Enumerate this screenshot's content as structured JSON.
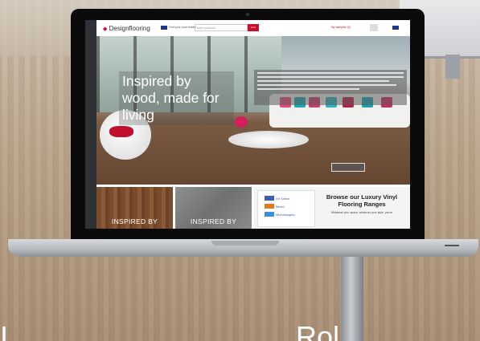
{
  "site": {
    "logo_text": "Designflooring",
    "dealer_text": "Find your local retailer",
    "search_placeholder": "enter postcode",
    "search_button": "Find",
    "samples_text": "My samples (0)",
    "lang_text": "EN"
  },
  "hero": {
    "title": "Inspired by wood, made for living"
  },
  "tiles": {
    "tile1_label": "INSPIRED BY",
    "tile2_label": "INSPIRED BY",
    "swatches": [
      {
        "name": "Art Select",
        "color": "#3f5fa8"
      },
      {
        "name": "Mixed",
        "color": "#e37a1f"
      },
      {
        "name": "Michelangelo",
        "color": "#3a8fd6"
      }
    ],
    "browse_title": "Browse our Luxury Vinyl Flooring Ranges",
    "browse_sub": "Whatever your space, whatever your style, you're"
  },
  "bottom_text": {
    "left": "I",
    "right": "Rol"
  },
  "colors": {
    "brand_red": "#c8102e",
    "laptop_bezel": "#0b0b0c"
  }
}
